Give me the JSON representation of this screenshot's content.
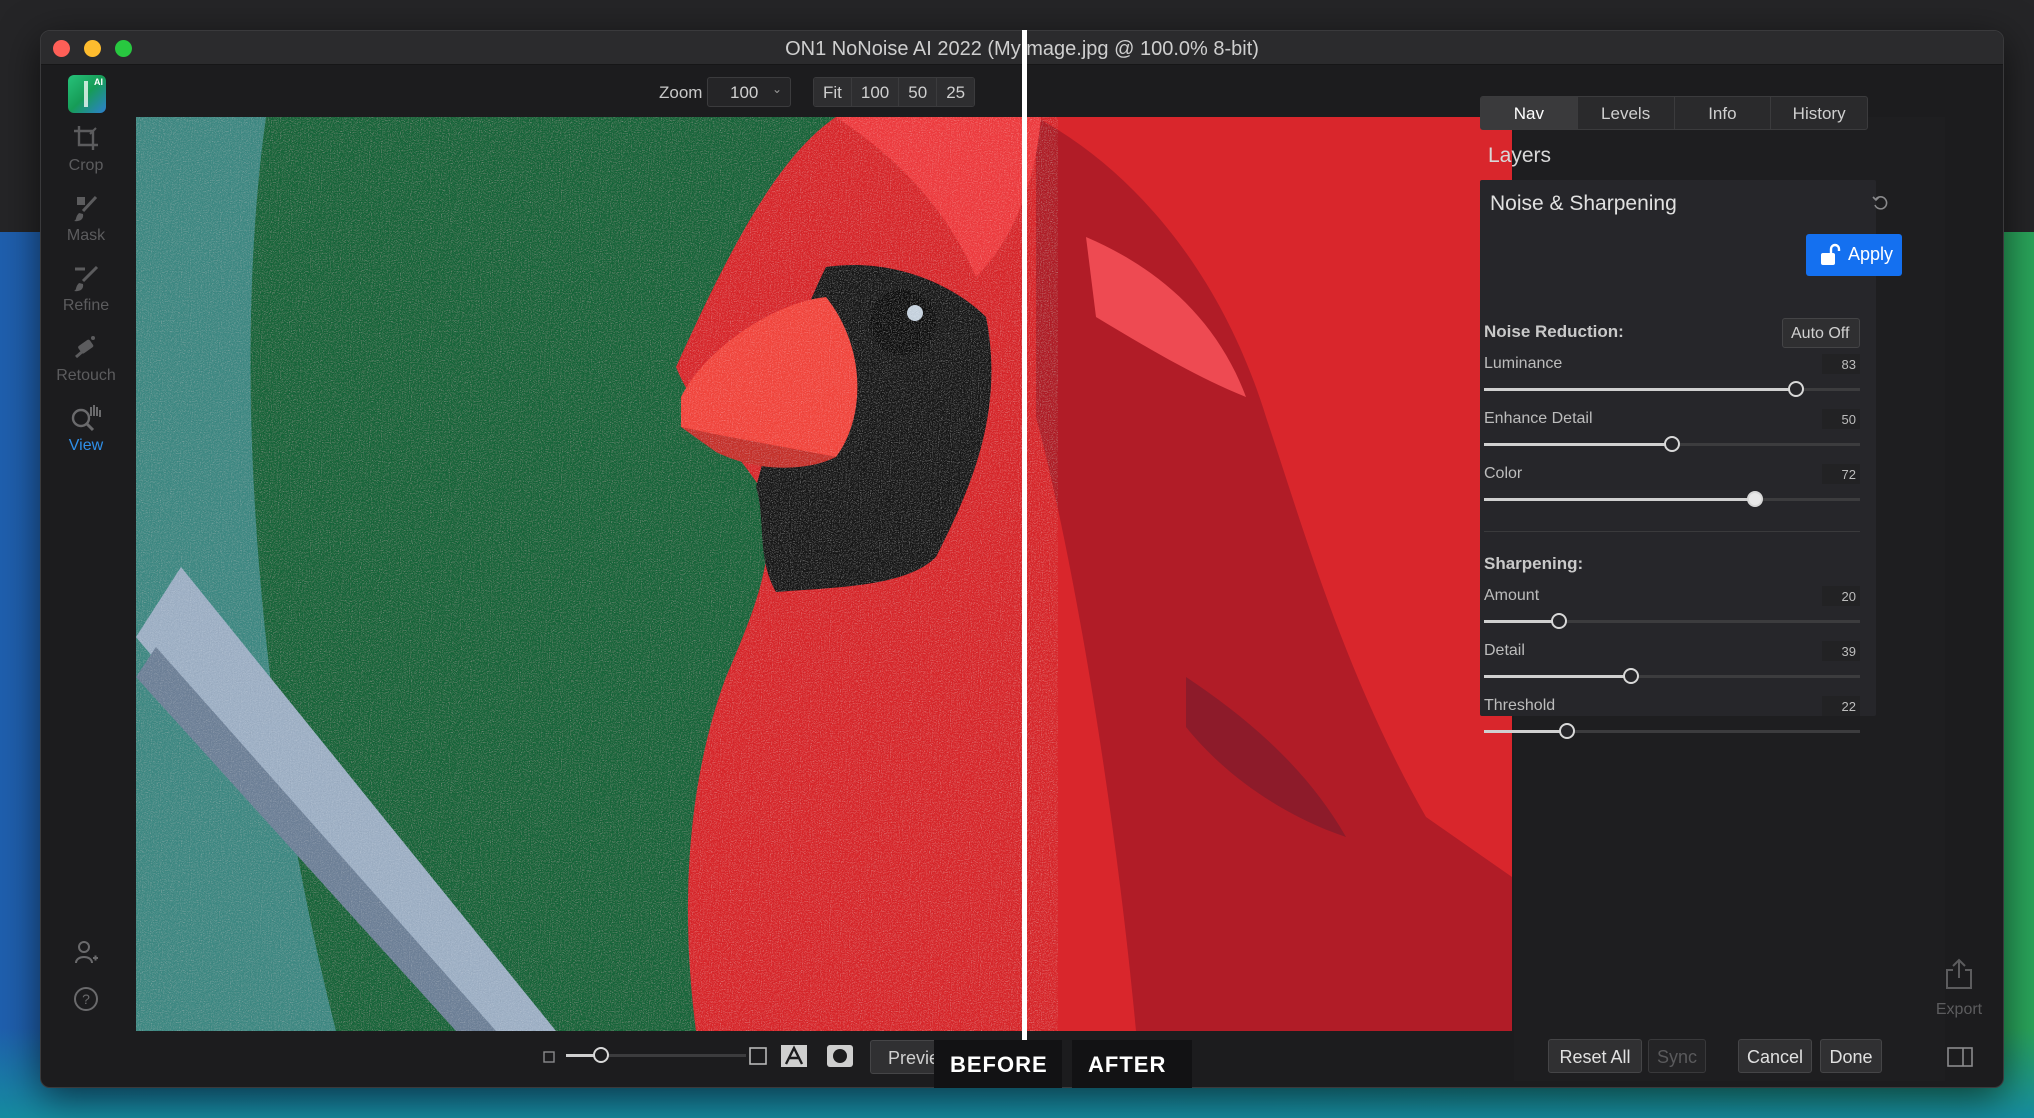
{
  "window": {
    "title": "ON1 NoNoise AI 2022 (MyImage.jpg @ 100.0% 8-bit)"
  },
  "app": {
    "logo_text": "AI",
    "logo_icon": "app-logo-icon"
  },
  "tools": [
    {
      "label": "Crop",
      "icon": "crop-icon"
    },
    {
      "label": "Mask",
      "icon": "mask-brush-icon"
    },
    {
      "label": "Refine",
      "icon": "refine-brush-icon"
    },
    {
      "label": "Retouch",
      "icon": "retouch-icon"
    },
    {
      "label": "View",
      "icon": "view-zoom-hand-icon",
      "active": true
    }
  ],
  "toolbar": {
    "zoom_label": "Zoom",
    "zoom_value": "100",
    "zoom_buttons": [
      "Fit",
      "100",
      "50",
      "25"
    ]
  },
  "compare": {
    "before_label": "BEFORE",
    "after_label": "AFTER",
    "preview_label": "Preview"
  },
  "panel": {
    "tabs": [
      "Nav",
      "Levels",
      "Info",
      "History"
    ],
    "active_tab": "Nav",
    "layers_title": "Layers",
    "section_title": "Noise & Sharpening",
    "apply_label": "Apply",
    "noise": {
      "title": "Noise Reduction:",
      "auto_label": "Auto Off",
      "sliders": [
        {
          "label": "Luminance",
          "value": "83",
          "percent": 83
        },
        {
          "label": "Enhance Detail",
          "value": "50",
          "percent": 50
        },
        {
          "label": "Color",
          "value": "72",
          "percent": 72
        }
      ]
    },
    "sharpening": {
      "title": "Sharpening:",
      "sliders": [
        {
          "label": "Amount",
          "value": "20",
          "percent": 20
        },
        {
          "label": "Detail",
          "value": "39",
          "percent": 39
        },
        {
          "label": "Threshold",
          "value": "22",
          "percent": 22
        }
      ]
    }
  },
  "footer": {
    "reset_all": "Reset All",
    "sync": "Sync",
    "cancel": "Cancel",
    "done": "Done",
    "export_label": "Export"
  },
  "colors": {
    "accent": "#1470f0",
    "active_tool": "#2f8fe8",
    "background": "#1c1c1e"
  }
}
